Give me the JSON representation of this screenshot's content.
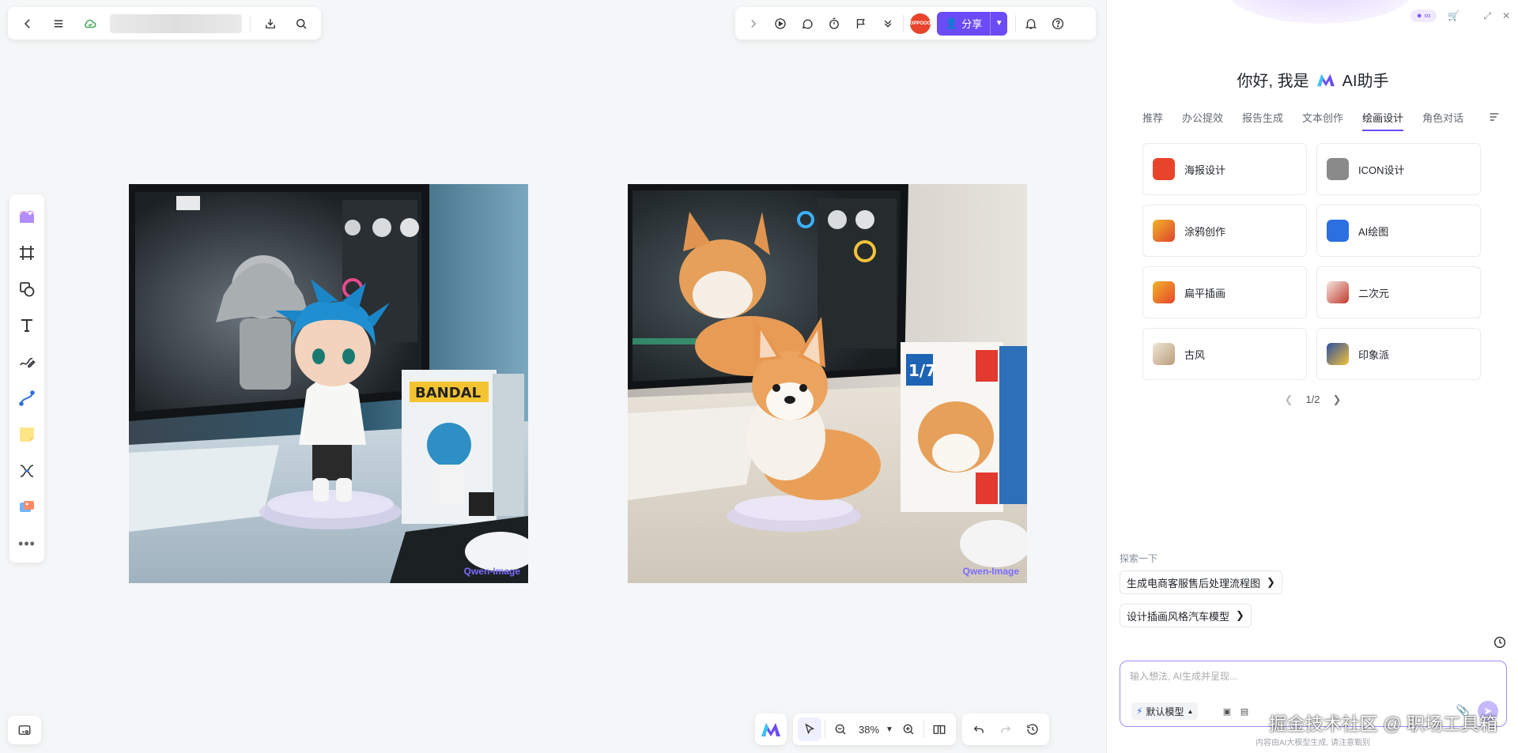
{
  "toolbar_left": {
    "back_icon": "chevron-left-icon",
    "menu_icon": "hamburger-icon",
    "cloud_icon": "cloud-sync-icon",
    "download_icon": "download-icon",
    "search_icon": "search-icon"
  },
  "toolbar_right": {
    "avatar_text": "OPPOOO",
    "share_label": "分享"
  },
  "canvas": {
    "images": [
      {
        "name": "anime-figure-image",
        "watermark": "Qwen-Image"
      },
      {
        "name": "corgi-figure-image",
        "watermark": "Qwen-Image"
      }
    ],
    "zoom": "38%"
  },
  "sidebar": {
    "greeting_prefix": "你好, 我是",
    "greeting_name": "AI助手",
    "tabs": [
      "推荐",
      "办公提效",
      "报告生成",
      "文本创作",
      "绘画设计",
      "角色对话"
    ],
    "active_tab": "绘画设计",
    "cards": [
      {
        "label": "海报设计",
        "color": "#e8442c"
      },
      {
        "label": "ICON设计",
        "color": "#7a7a7a"
      },
      {
        "label": "涂鸦创作",
        "color": "#e07a2c"
      },
      {
        "label": "AI绘图",
        "color": "#2c6fe0"
      },
      {
        "label": "扁平插画",
        "color": "#f0b429"
      },
      {
        "label": "二次元",
        "color": "#c0392b"
      },
      {
        "label": "古风",
        "color": "#c8b69a"
      },
      {
        "label": "印象派",
        "color": "#2d4fa0"
      }
    ],
    "pager": "1/2",
    "explore_label": "探索一下",
    "suggestions": [
      "生成电商客服售后处理流程图",
      "设计插画风格汽车模型"
    ],
    "input_placeholder": "输入想法, AI生成并呈现...",
    "model_label": "默认模型",
    "disclaimer": "内容由AI大模型生成, 请注意甄别",
    "overlay_watermark": "掘金技术社区 @ 职场工具箱"
  },
  "colors": {
    "accent": "#6b4bf6",
    "input_border": "#9d8cf6"
  }
}
